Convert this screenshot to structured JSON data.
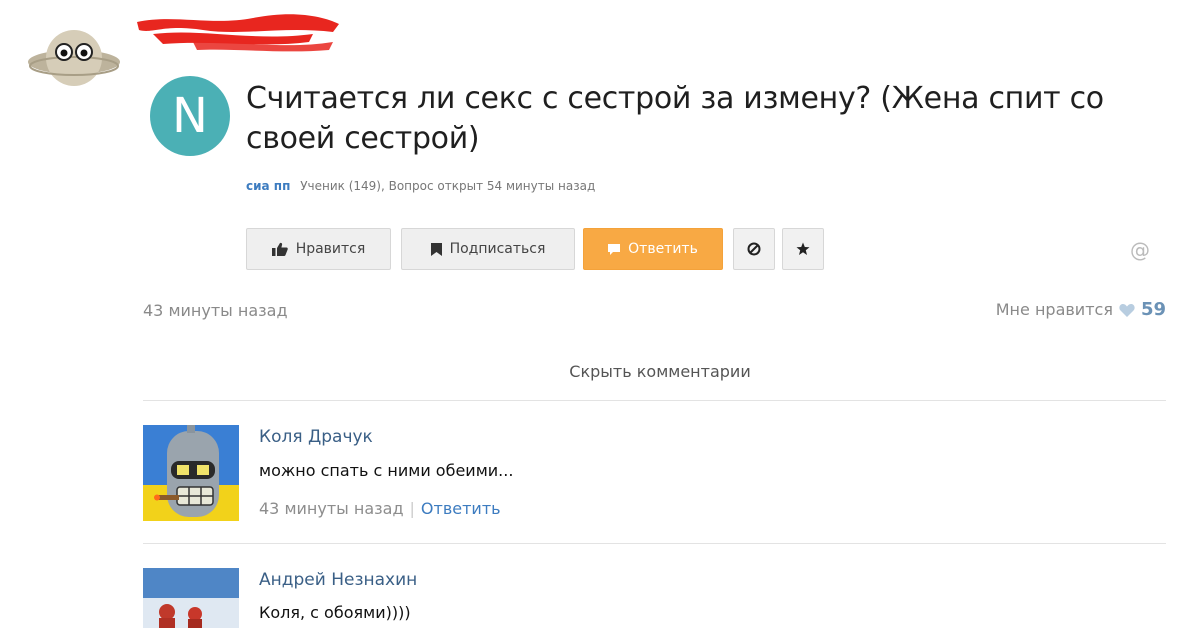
{
  "question": {
    "avatar_letter": "N",
    "title": "Считается ли секс с сестрой за измену? (Жена спит со своей сестрой)",
    "author": "сиа пп",
    "meta": "Ученик (149), Вопрос открыт 54 минуты назад"
  },
  "actions": {
    "like_label": "Нравится",
    "subscribe_label": "Подписаться",
    "reply_label": "Ответить"
  },
  "post": {
    "time": "43 минуты назад",
    "likes_label": "Мне нравится",
    "likes_count": "59"
  },
  "hide_comments": "Скрыть комментарии",
  "comments": [
    {
      "name": "Коля Драчук",
      "text": "можно спать с ними обеими...",
      "time": "43 минуты назад",
      "reply_label": "Ответить"
    },
    {
      "name": "Андрей Незнахин",
      "text": "Коля, с обоями))))"
    }
  ],
  "icons": {
    "like": "thumbs-up-icon",
    "subscribe": "bookmark-icon",
    "reply": "comment-icon",
    "block": "block-icon",
    "star": "star-icon",
    "mention": "at-icon",
    "heart": "heart-icon"
  },
  "colors": {
    "avatar_teal": "#4bb0b5",
    "reply_orange": "#f8a944",
    "link_blue": "#3d7cc0",
    "censor_red": "#e8261f"
  }
}
